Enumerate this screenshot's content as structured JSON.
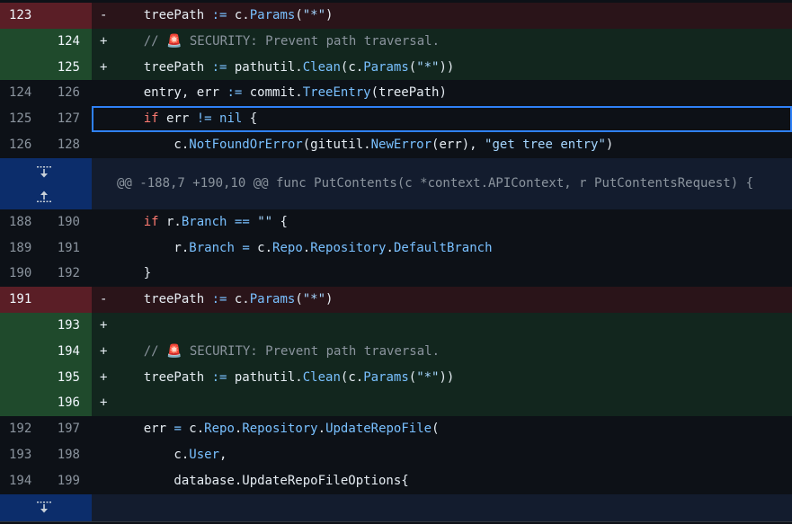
{
  "rows": [
    {
      "type": "del",
      "old": "123",
      "new": "",
      "mark": "-",
      "tokens": [
        [
          "var",
          "    treePath "
        ],
        [
          "op",
          ":="
        ],
        [
          "var",
          " c."
        ],
        [
          "fn",
          "Params"
        ],
        [
          "var",
          "("
        ],
        [
          "str",
          "\"*\""
        ],
        [
          "var",
          ")"
        ]
      ]
    },
    {
      "type": "add",
      "old": "",
      "new": "124",
      "mark": "+",
      "tokens": [
        [
          "var",
          "    "
        ],
        [
          "cm",
          "// 🚨 SECURITY: Prevent path traversal."
        ]
      ]
    },
    {
      "type": "add",
      "old": "",
      "new": "125",
      "mark": "+",
      "tokens": [
        [
          "var",
          "    treePath "
        ],
        [
          "op",
          ":="
        ],
        [
          "var",
          " pathutil."
        ],
        [
          "fn",
          "Clean"
        ],
        [
          "var",
          "(c."
        ],
        [
          "fn",
          "Params"
        ],
        [
          "var",
          "("
        ],
        [
          "str",
          "\"*\""
        ],
        [
          "var",
          "))"
        ]
      ]
    },
    {
      "type": "ctx",
      "old": "124",
      "new": "126",
      "mark": "",
      "tokens": [
        [
          "var",
          "    entry, err "
        ],
        [
          "op",
          ":="
        ],
        [
          "var",
          " commit."
        ],
        [
          "fn",
          "TreeEntry"
        ],
        [
          "var",
          "(treePath)"
        ]
      ]
    },
    {
      "type": "ctx",
      "old": "125",
      "new": "127",
      "mark": "",
      "selected": true,
      "tokens": [
        [
          "var",
          "    "
        ],
        [
          "kw",
          "if"
        ],
        [
          "var",
          " err "
        ],
        [
          "op",
          "!="
        ],
        [
          "var",
          " "
        ],
        [
          "op",
          "nil"
        ],
        [
          "var",
          " {"
        ]
      ]
    },
    {
      "type": "ctx",
      "old": "126",
      "new": "128",
      "mark": "",
      "tokens": [
        [
          "var",
          "        c."
        ],
        [
          "fn",
          "NotFoundOrError"
        ],
        [
          "var",
          "(gitutil."
        ],
        [
          "fn",
          "NewError"
        ],
        [
          "var",
          "(err), "
        ],
        [
          "str",
          "\"get tree entry\""
        ],
        [
          "var",
          ")"
        ]
      ]
    },
    {
      "type": "hunk",
      "text": "@@ -188,7 +190,10 @@ func PutContents(c *context.APIContext, r PutContentsRequest) {"
    },
    {
      "type": "ctx",
      "old": "188",
      "new": "190",
      "mark": "",
      "tokens": [
        [
          "var",
          "    "
        ],
        [
          "kw",
          "if"
        ],
        [
          "var",
          " r."
        ],
        [
          "fn",
          "Branch"
        ],
        [
          "var",
          " "
        ],
        [
          "op",
          "=="
        ],
        [
          "var",
          " "
        ],
        [
          "str",
          "\"\""
        ],
        [
          "var",
          " {"
        ]
      ]
    },
    {
      "type": "ctx",
      "old": "189",
      "new": "191",
      "mark": "",
      "tokens": [
        [
          "var",
          "        r."
        ],
        [
          "fn",
          "Branch"
        ],
        [
          "var",
          " "
        ],
        [
          "op",
          "="
        ],
        [
          "var",
          " c."
        ],
        [
          "fn",
          "Repo"
        ],
        [
          "var",
          "."
        ],
        [
          "fn",
          "Repository"
        ],
        [
          "var",
          "."
        ],
        [
          "fn",
          "DefaultBranch"
        ]
      ]
    },
    {
      "type": "ctx",
      "old": "190",
      "new": "192",
      "mark": "",
      "tokens": [
        [
          "var",
          "    }"
        ]
      ]
    },
    {
      "type": "del",
      "old": "191",
      "new": "",
      "mark": "-",
      "tokens": [
        [
          "var",
          "    treePath "
        ],
        [
          "op",
          ":="
        ],
        [
          "var",
          " c."
        ],
        [
          "fn",
          "Params"
        ],
        [
          "var",
          "("
        ],
        [
          "str",
          "\"*\""
        ],
        [
          "var",
          ")"
        ]
      ]
    },
    {
      "type": "add",
      "old": "",
      "new": "193",
      "mark": "+",
      "tokens": []
    },
    {
      "type": "add",
      "old": "",
      "new": "194",
      "mark": "+",
      "tokens": [
        [
          "var",
          "    "
        ],
        [
          "cm",
          "// 🚨 SECURITY: Prevent path traversal."
        ]
      ]
    },
    {
      "type": "add",
      "old": "",
      "new": "195",
      "mark": "+",
      "tokens": [
        [
          "var",
          "    treePath "
        ],
        [
          "op",
          ":="
        ],
        [
          "var",
          " pathutil."
        ],
        [
          "fn",
          "Clean"
        ],
        [
          "var",
          "(c."
        ],
        [
          "fn",
          "Params"
        ],
        [
          "var",
          "("
        ],
        [
          "str",
          "\"*\""
        ],
        [
          "var",
          "))"
        ]
      ]
    },
    {
      "type": "add",
      "old": "",
      "new": "196",
      "mark": "+",
      "tokens": []
    },
    {
      "type": "ctx",
      "old": "192",
      "new": "197",
      "mark": "",
      "tokens": [
        [
          "var",
          "    err "
        ],
        [
          "op",
          "="
        ],
        [
          "var",
          " c."
        ],
        [
          "fn",
          "Repo"
        ],
        [
          "var",
          "."
        ],
        [
          "fn",
          "Repository"
        ],
        [
          "var",
          "."
        ],
        [
          "fn",
          "UpdateRepoFile"
        ],
        [
          "var",
          "("
        ]
      ]
    },
    {
      "type": "ctx",
      "old": "193",
      "new": "198",
      "mark": "",
      "tokens": [
        [
          "var",
          "        c."
        ],
        [
          "fn",
          "User"
        ],
        [
          "var",
          ","
        ]
      ]
    },
    {
      "type": "ctx",
      "old": "194",
      "new": "199",
      "mark": "",
      "tokens": [
        [
          "var",
          "        database.UpdateRepoFileOptions{"
        ]
      ]
    },
    {
      "type": "tail"
    }
  ],
  "colors": {
    "accent": "#2f81f7",
    "deleted": "#5a1e26",
    "added": "#1f4a2c"
  },
  "icons": {
    "expand_down": "unfold-down-icon",
    "expand_up": "unfold-up-icon"
  }
}
